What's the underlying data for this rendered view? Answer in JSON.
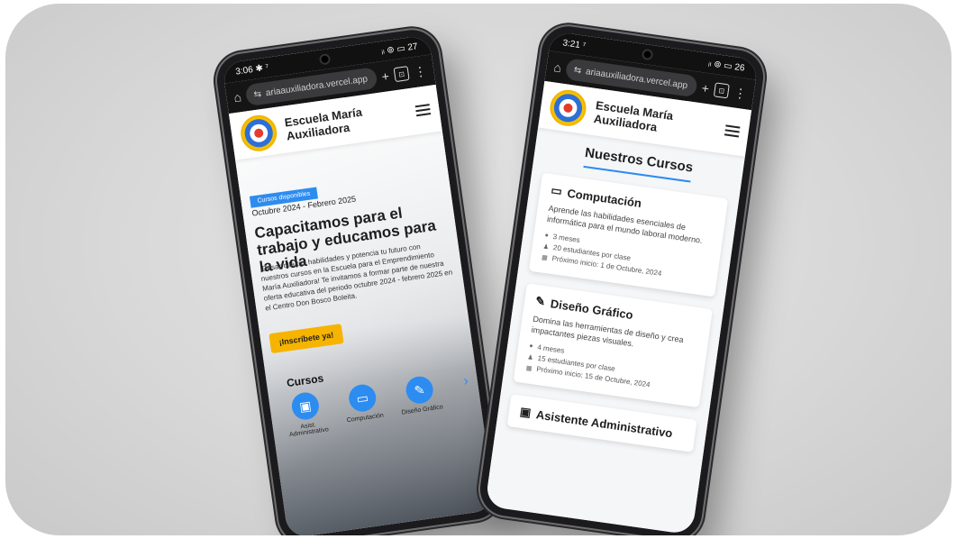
{
  "phone_left": {
    "status": {
      "time": "3:06 ✱ ⁷",
      "icons": "ᵢₗ ⊚ ▭ 27"
    },
    "url": "ariaauxiliadora.vercel.app",
    "site_name": "Escuela María Auxiliadora",
    "badge": "Cursos disponibles",
    "dates": "Octubre 2024 - Febrero 2025",
    "headline": "Capacitamos para el trabajo y educamos para la vida",
    "paragraph": "¡Desarrolla tus habilidades y potencia tu futuro con nuestros cursos en la Escuela para el Emprendimiento María Auxiliadora! Te invitamos a formar parte de nuestra oferta educativa del periodo octubre 2024 - febrero 2025 en el Centro Don Bosco Boleita.",
    "cta": "¡Inscríbete ya!",
    "courses_title": "Cursos",
    "courses": [
      {
        "label": "Asist. Administrativo",
        "icon": "briefcase-icon"
      },
      {
        "label": "Computación",
        "icon": "laptop-icon"
      },
      {
        "label": "Diseño Gráfico",
        "icon": "pen-icon"
      }
    ]
  },
  "phone_right": {
    "status": {
      "time": "3:21 ⁷",
      "icons": "ᵢₗ ⊚ ▭ 26"
    },
    "url": "ariaauxiliadora.vercel.app",
    "site_name": "Escuela María Auxiliadora",
    "page_title": "Nuestros Cursos",
    "cards": [
      {
        "title": "Computación",
        "icon": "laptop-icon",
        "description": "Aprende las habilidades esenciales de informática para el mundo laboral moderno.",
        "duration": "3 meses",
        "students": "20 estudiantes por clase",
        "start": "Próximo inicio: 1 de Octubre, 2024"
      },
      {
        "title": "Diseño Gráfico",
        "icon": "pen-icon",
        "description": "Domina las herramientas de diseño y crea impactantes piezas visuales.",
        "duration": "4 meses",
        "students": "15 estudiantes por clase",
        "start": "Próximo inicio: 15 de Octubre, 2024"
      },
      {
        "title": "Asistente Administrativo",
        "icon": "briefcase-icon"
      }
    ]
  },
  "colors": {
    "accent": "#2d8cf0",
    "cta": "#f6b400"
  }
}
